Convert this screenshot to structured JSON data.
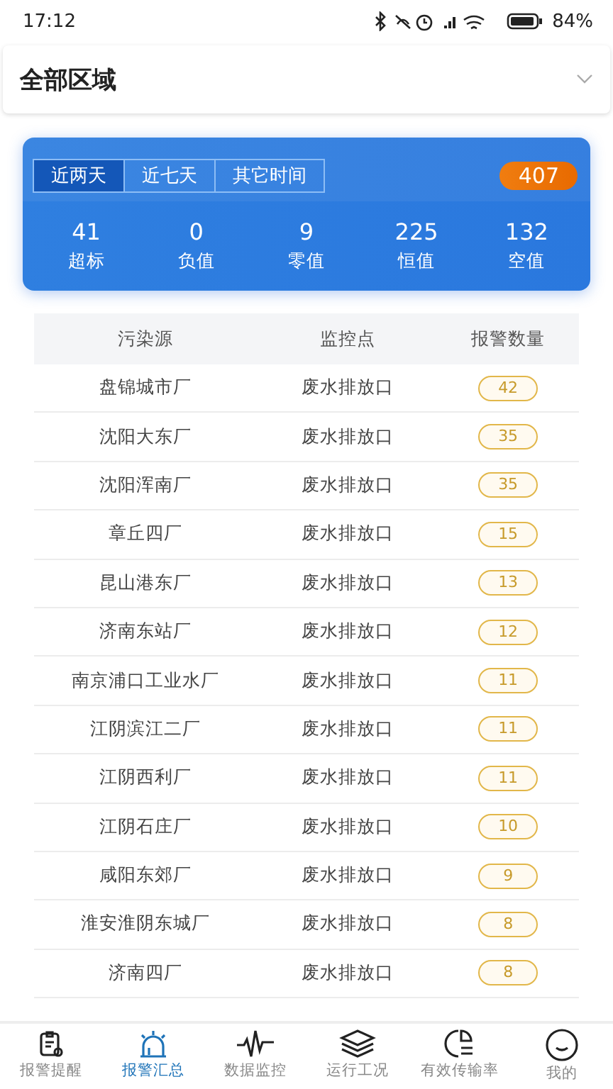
{
  "status_bar": {
    "time": "17:12",
    "battery": "84%"
  },
  "region": {
    "label": "全部区域"
  },
  "summary": {
    "tabs": [
      {
        "label": "近两天",
        "selected": true
      },
      {
        "label": "近七天",
        "selected": false
      },
      {
        "label": "其它时间",
        "selected": false
      }
    ],
    "total": "407",
    "stats": [
      {
        "value": "41",
        "label": "超标"
      },
      {
        "value": "0",
        "label": "负值"
      },
      {
        "value": "9",
        "label": "零值"
      },
      {
        "value": "225",
        "label": "恒值"
      },
      {
        "value": "132",
        "label": "空值"
      }
    ]
  },
  "table": {
    "columns": [
      "污染源",
      "监控点",
      "报警数量"
    ],
    "rows": [
      {
        "source": "盘锦城市厂",
        "point": "废水排放口",
        "count": "42"
      },
      {
        "source": "沈阳大东厂",
        "point": "废水排放口",
        "count": "35"
      },
      {
        "source": "沈阳浑南厂",
        "point": "废水排放口",
        "count": "35"
      },
      {
        "source": "章丘四厂",
        "point": "废水排放口",
        "count": "15"
      },
      {
        "source": "昆山港东厂",
        "point": "废水排放口",
        "count": "13"
      },
      {
        "source": "济南东站厂",
        "point": "废水排放口",
        "count": "12"
      },
      {
        "source": "南京浦口工业水厂",
        "point": "废水排放口",
        "count": "11"
      },
      {
        "source": "江阴滨江二厂",
        "point": "废水排放口",
        "count": "11"
      },
      {
        "source": "江阴西利厂",
        "point": "废水排放口",
        "count": "11"
      },
      {
        "source": "江阴石庄厂",
        "point": "废水排放口",
        "count": "10"
      },
      {
        "source": "咸阳东郊厂",
        "point": "废水排放口",
        "count": "9"
      },
      {
        "source": "淮安淮阴东城厂",
        "point": "废水排放口",
        "count": "8"
      },
      {
        "source": "济南四厂",
        "point": "废水排放口",
        "count": "8"
      }
    ]
  },
  "nav": [
    {
      "label": "报警提醒",
      "selected": false
    },
    {
      "label": "报警汇总",
      "selected": true
    },
    {
      "label": "数据监控",
      "selected": false
    },
    {
      "label": "运行工况",
      "selected": false
    },
    {
      "label": "有效传输率",
      "selected": false
    },
    {
      "label": "我的",
      "selected": false
    }
  ]
}
